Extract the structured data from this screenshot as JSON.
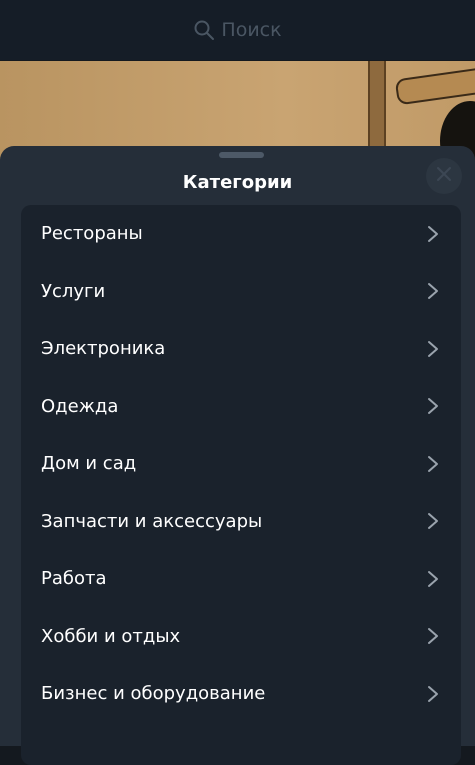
{
  "search": {
    "placeholder": "Поиск",
    "icon": "search-icon"
  },
  "sheet": {
    "title": "Категории",
    "close_icon": "close-icon",
    "categories": [
      {
        "label": "Рестораны"
      },
      {
        "label": "Услуги"
      },
      {
        "label": "Электроника"
      },
      {
        "label": "Одежда"
      },
      {
        "label": "Дом и сад"
      },
      {
        "label": "Запчасти и аксессуары"
      },
      {
        "label": "Работа"
      },
      {
        "label": "Хобби и отдых"
      },
      {
        "label": "Бизнес и оборудование"
      }
    ],
    "item_icon": "chevron-right-icon"
  },
  "colors": {
    "background": "#14191f",
    "sheet": "#252e39",
    "list": "#1a222c",
    "text": "#ffffff",
    "muted": "#4a5663",
    "chevron": "#9aa3ad"
  }
}
